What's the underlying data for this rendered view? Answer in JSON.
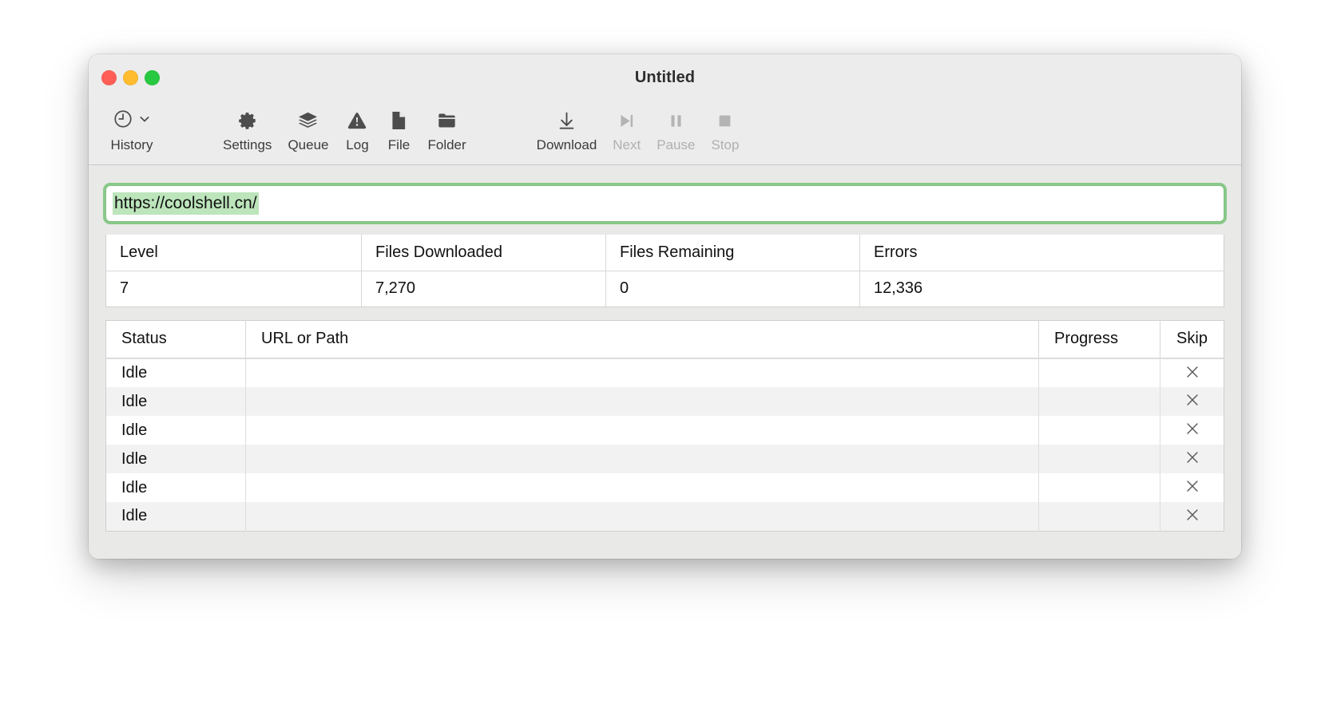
{
  "window": {
    "title": "Untitled",
    "traffic_lights": [
      {
        "name": "close",
        "color": "#ff5f57"
      },
      {
        "name": "minimize",
        "color": "#febc2e"
      },
      {
        "name": "maximize",
        "color": "#28c840"
      }
    ]
  },
  "toolbar": {
    "items": [
      {
        "id": "history",
        "label": "History",
        "icon": "clock-icon",
        "has_chevron": true,
        "enabled": true
      },
      {
        "id": "settings",
        "label": "Settings",
        "icon": "gear-icon",
        "has_chevron": false,
        "enabled": true
      },
      {
        "id": "queue",
        "label": "Queue",
        "icon": "layers-icon",
        "has_chevron": false,
        "enabled": true
      },
      {
        "id": "log",
        "label": "Log",
        "icon": "warning-icon",
        "has_chevron": false,
        "enabled": true
      },
      {
        "id": "file",
        "label": "File",
        "icon": "document-icon",
        "has_chevron": false,
        "enabled": true
      },
      {
        "id": "folder",
        "label": "Folder",
        "icon": "folder-icon",
        "has_chevron": false,
        "enabled": true
      },
      {
        "id": "download",
        "label": "Download",
        "icon": "download-arrow-icon",
        "has_chevron": false,
        "enabled": true
      },
      {
        "id": "next",
        "label": "Next",
        "icon": "skip-forward-icon",
        "has_chevron": false,
        "enabled": false
      },
      {
        "id": "pause",
        "label": "Pause",
        "icon": "pause-icon",
        "has_chevron": false,
        "enabled": false
      },
      {
        "id": "stop",
        "label": "Stop",
        "icon": "stop-icon",
        "has_chevron": false,
        "enabled": false
      }
    ]
  },
  "url_field": {
    "value": "https://coolshell.cn/",
    "placeholder": "Enter URL",
    "focused": true,
    "selected": true,
    "focus_ring_color": "#78c378",
    "selection_color": "#bce5bb"
  },
  "stats": {
    "headers": [
      "Level",
      "Files Downloaded",
      "Files Remaining",
      "Errors"
    ],
    "values": [
      "7",
      "7,270",
      "0",
      "12,336"
    ]
  },
  "queue": {
    "headers": [
      "Status",
      "URL or Path",
      "Progress",
      "Skip"
    ],
    "skip_icon": "close-x-icon",
    "rows": [
      {
        "status": "Idle",
        "url": "",
        "progress": ""
      },
      {
        "status": "Idle",
        "url": "",
        "progress": ""
      },
      {
        "status": "Idle",
        "url": "",
        "progress": ""
      },
      {
        "status": "Idle",
        "url": "",
        "progress": ""
      },
      {
        "status": "Idle",
        "url": "",
        "progress": ""
      },
      {
        "status": "Idle",
        "url": "",
        "progress": ""
      }
    ]
  }
}
